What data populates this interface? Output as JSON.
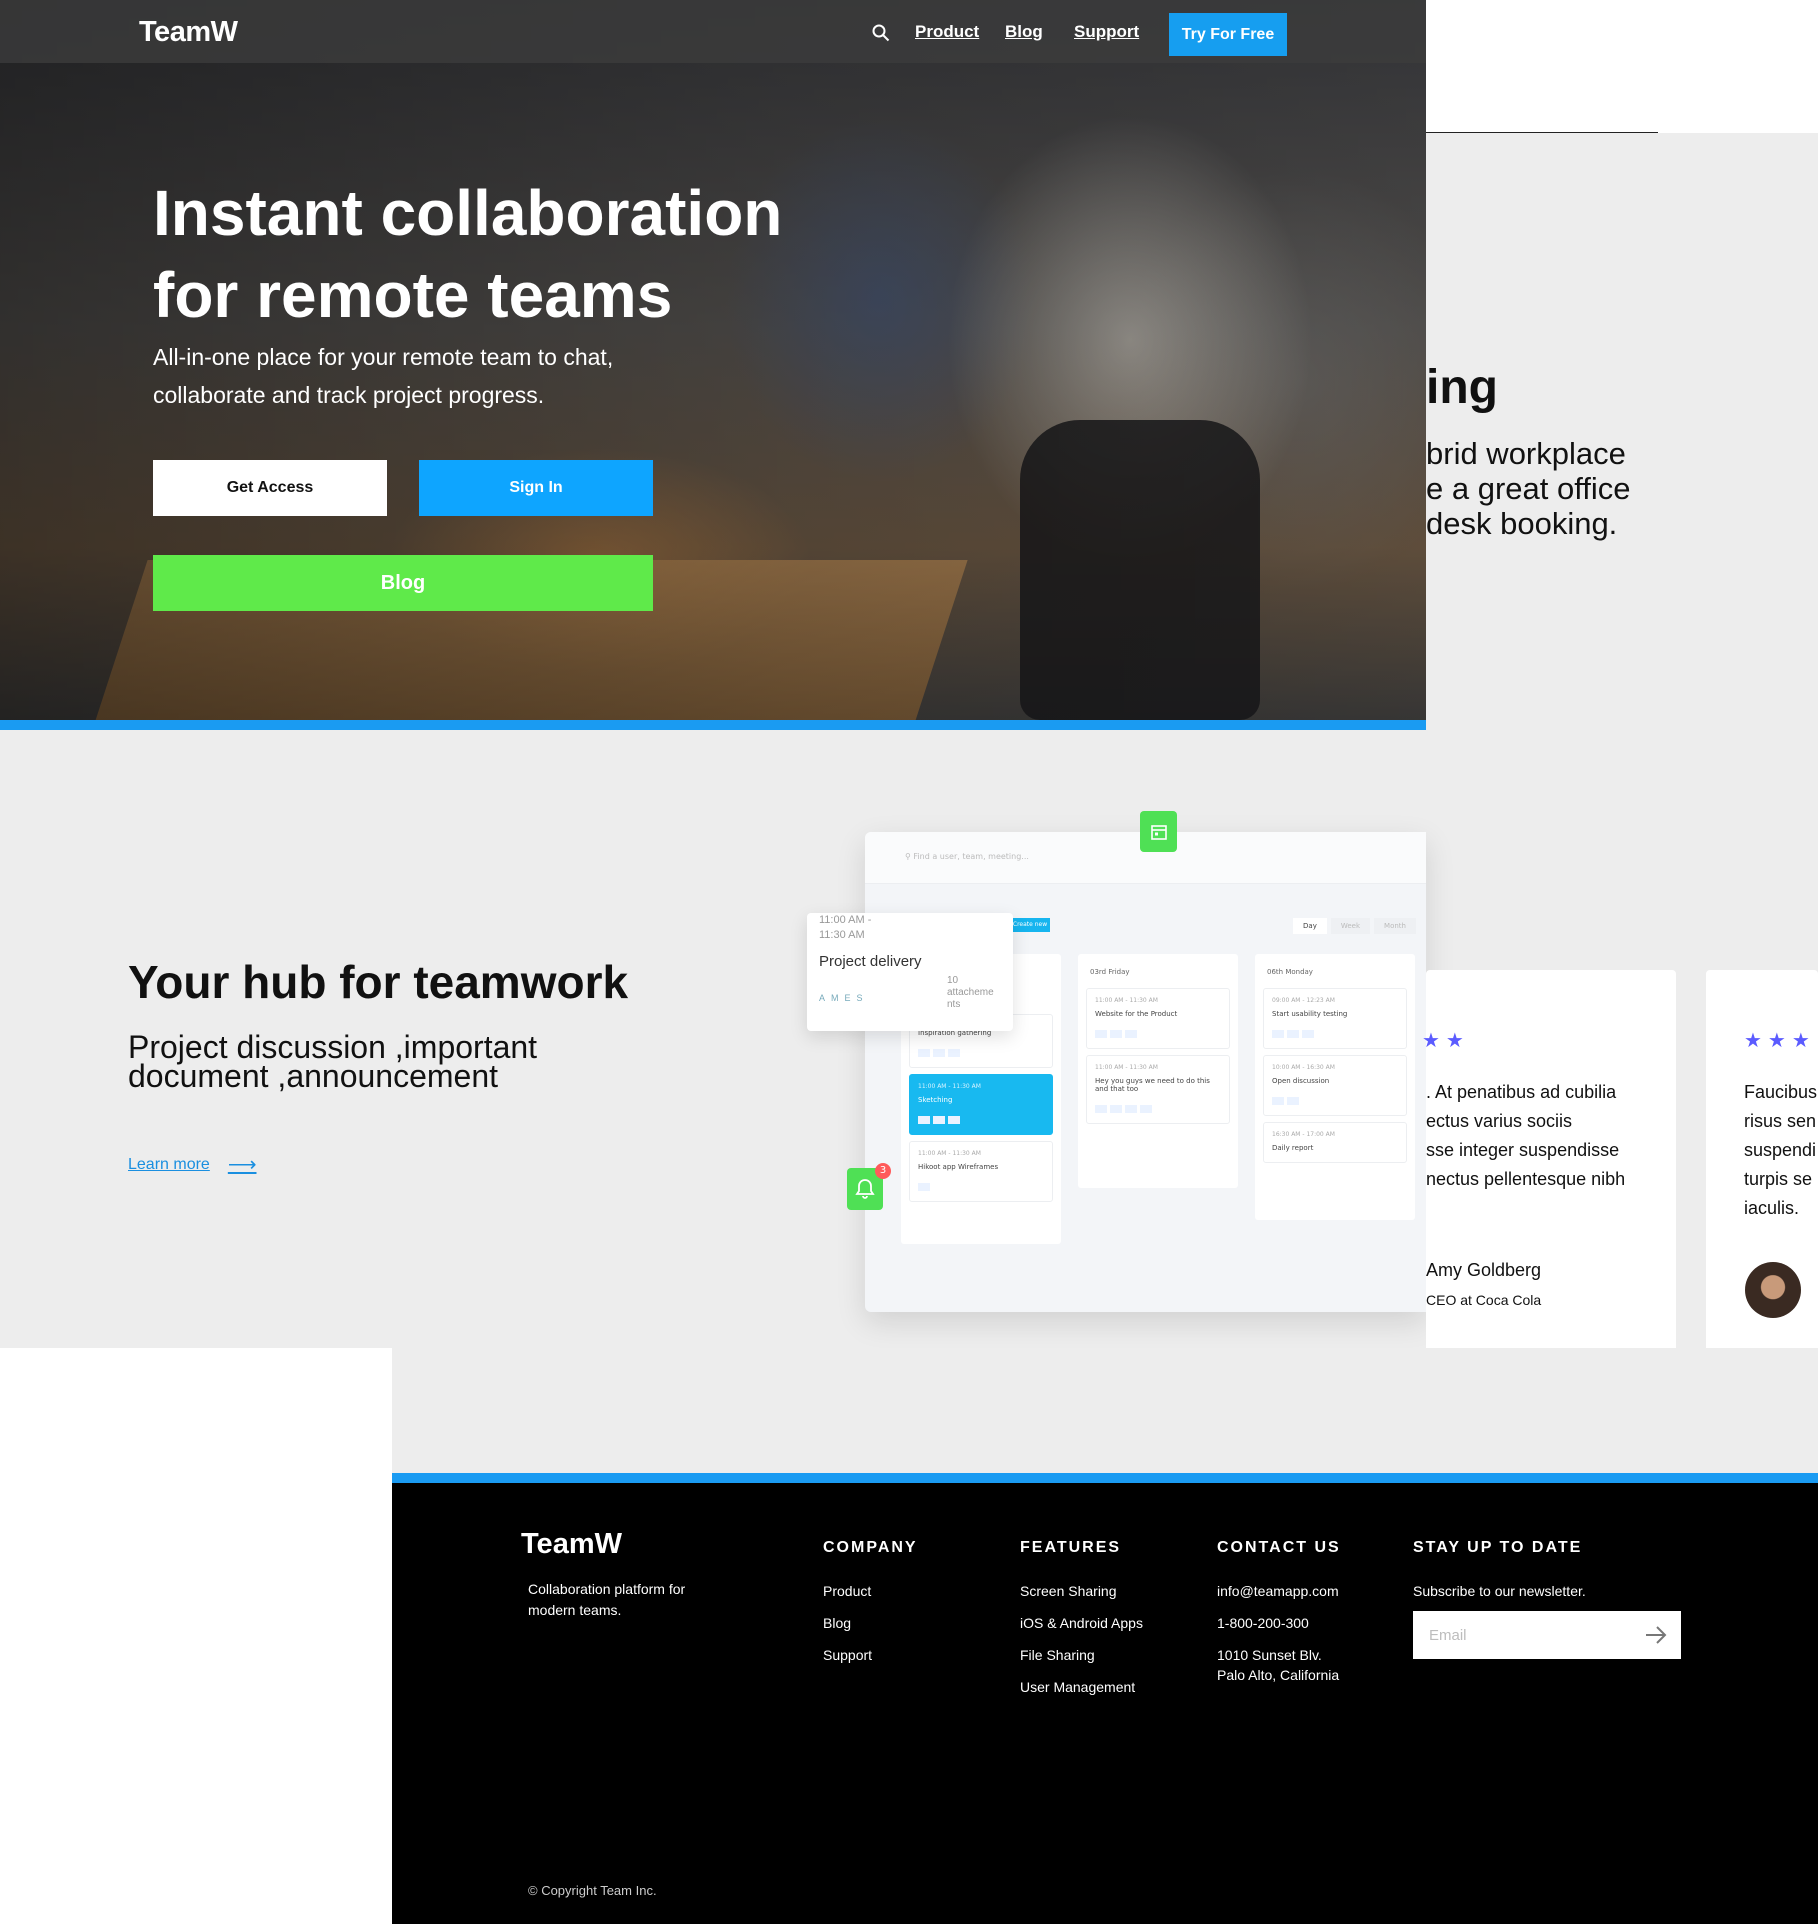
{
  "nav": {
    "logo": "TeamW",
    "links": [
      "Product",
      "Blog",
      "Support"
    ],
    "cta": "Try For Free"
  },
  "hero": {
    "title_line1": "Instant collaboration",
    "title_line2": "for remote teams",
    "subtitle": "All-in-one place for your remote team to chat, collaborate and track project progress.",
    "get_access": "Get Access",
    "sign_in": "Sign In",
    "blog": "Blog"
  },
  "partial_section": {
    "heading": "ing",
    "paragraph_lines": [
      "brid workplace",
      "e a great office",
      "desk booking."
    ]
  },
  "hub": {
    "title": "Your hub for teamwork",
    "subtitle_line1": "Project discussion ,important",
    "subtitle_line2": "document ,announcement",
    "learn_more": "Learn more"
  },
  "app_mock": {
    "search_placeholder": "Find a user, team, meeting...",
    "create_label": "Create new",
    "tabs": [
      "Day",
      "Week",
      "Month"
    ],
    "columns": [
      {
        "title": "",
        "cards": [
          {
            "time": "",
            "title": "Inspiration gathering"
          },
          {
            "time": "11:00 AM - 11:30 AM",
            "title": "Sketching",
            "highlight": true
          },
          {
            "time": "11:00 AM - 11:30 AM",
            "title": "Hikoot app Wireframes"
          }
        ]
      },
      {
        "title": "03rd Friday",
        "cards": [
          {
            "time": "11:00 AM - 11:30 AM",
            "title": "Website for the Product"
          },
          {
            "time": "11:00 AM - 11:30 AM",
            "title": "Hey you guys we need to do this and that too"
          }
        ]
      },
      {
        "title": "06th Monday",
        "cards": [
          {
            "time": "09:00 AM - 12:23 AM",
            "title": "Start usability testing"
          },
          {
            "time": "10:00 AM - 16:30 AM",
            "title": "Open discussion"
          },
          {
            "time": "16:30 AM - 17:00 AM",
            "title": "Daily report"
          }
        ]
      }
    ],
    "float_card": {
      "time": "11:00 AM - 11:30 AM",
      "title": "Project delivery",
      "attachments": "10 attacheme nts",
      "avatars": [
        "A",
        "M",
        "E",
        "S"
      ]
    },
    "notification_count": "3"
  },
  "testimonials": [
    {
      "stars": "★★",
      "text_lines": [
        ". At penatibus ad cubilia",
        "ectus varius sociis",
        "sse integer suspendisse",
        "nectus pellentesque nibh"
      ],
      "name": "Amy Goldberg",
      "role": "CEO at Coca Cola"
    },
    {
      "stars": "★★★",
      "text_lines": [
        "Faucibus",
        "risus sen",
        "suspendi",
        "turpis se",
        "iaculis."
      ],
      "name": "",
      "role": ""
    }
  ],
  "footer": {
    "logo": "TeamW",
    "tagline": "Collaboration platform for modern teams.",
    "company": {
      "heading": "COMPANY",
      "items": [
        "Product",
        "Blog",
        "Support"
      ]
    },
    "features": {
      "heading": "FEATURES",
      "items": [
        "Screen Sharing",
        "iOS & Android Apps",
        "File Sharing",
        "User Management"
      ]
    },
    "contact": {
      "heading": "CONTACT US",
      "items": [
        "info@teamapp.com",
        "1-800-200-300",
        "1010 Sunset Blv.",
        "Palo Alto, California"
      ]
    },
    "newsletter": {
      "heading": "STAY UP TO DATE",
      "text": "Subscribe to our newsletter.",
      "placeholder": "Email"
    },
    "copyright": "© Copyright Team Inc."
  },
  "colors": {
    "primary_blue": "#1a9bf2",
    "green": "#5fea4a",
    "star": "#5b5bff"
  }
}
